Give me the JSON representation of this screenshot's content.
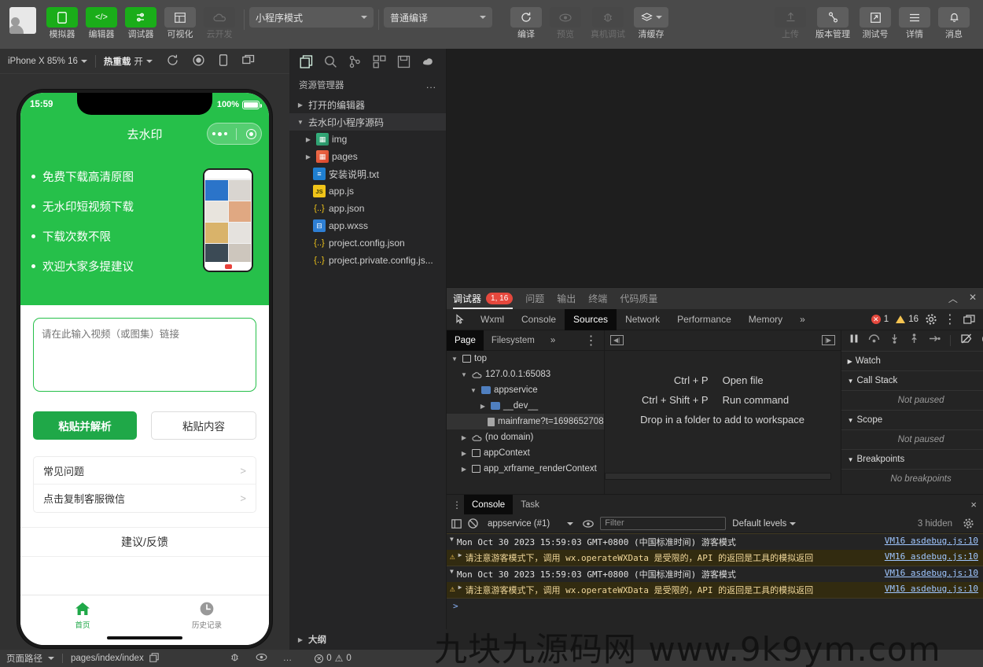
{
  "toolbar": {
    "avatar_name": "user-avatar",
    "items": [
      {
        "label": "模拟器",
        "icon": "phone-icon",
        "style": "green"
      },
      {
        "label": "编辑器",
        "icon": "code-icon",
        "style": "green"
      },
      {
        "label": "调试器",
        "icon": "debug-icon",
        "style": "green"
      },
      {
        "label": "可视化",
        "icon": "layout-icon",
        "style": "grey"
      },
      {
        "label": "云开发",
        "icon": "cloud-icon",
        "style": "dim",
        "disabled": true
      }
    ],
    "mode_select": "小程序模式",
    "compile_select": "普通编译",
    "actions": [
      {
        "label": "编译",
        "icon": "refresh-icon",
        "disabled": false
      },
      {
        "label": "预览",
        "icon": "eye-icon",
        "disabled": true
      },
      {
        "label": "真机调试",
        "icon": "bug-icon",
        "disabled": true
      },
      {
        "label": "清缓存",
        "icon": "layers-icon",
        "disabled": false
      }
    ],
    "right_actions": [
      {
        "label": "上传",
        "icon": "upload-icon",
        "disabled": true
      },
      {
        "label": "版本管理",
        "icon": "branch-icon",
        "disabled": false
      },
      {
        "label": "测试号",
        "icon": "external-link-icon",
        "disabled": false
      },
      {
        "label": "详情",
        "icon": "menu-icon",
        "disabled": false
      },
      {
        "label": "消息",
        "icon": "bell-icon",
        "disabled": false
      }
    ]
  },
  "simulator": {
    "device": "iPhone X 85% 16",
    "hotreload_label": "热重载",
    "hotreload_value": "开",
    "icons": [
      "rotate-icon",
      "record-icon",
      "device-icon",
      "multiscreen-icon"
    ],
    "phone": {
      "status_time": "15:59",
      "battery_text": "100%",
      "nav_title": "去水印",
      "promo_items": [
        "免费下载高清原图",
        "无水印短视频下载",
        "下载次数不限",
        "欢迎大家多提建议"
      ],
      "input_placeholder": "请在此输入视频（或图集）链接",
      "input_value": "",
      "primary_button": "粘贴并解析",
      "ghost_button": "粘贴内容",
      "menu_rows": [
        {
          "label": "常见问题",
          "chevron": ">"
        },
        {
          "label": "点击复制客服微信",
          "chevron": ">"
        }
      ],
      "feedback_label": "建议/反馈",
      "tabs": [
        {
          "label": "首页",
          "icon": "home-icon",
          "active": true
        },
        {
          "label": "历史记录",
          "icon": "clock-icon",
          "active": false
        }
      ]
    }
  },
  "explorer": {
    "activity_icons": [
      "files-icon",
      "search-icon",
      "source-control-icon",
      "extensions-icon",
      "save-icon",
      "plugin-icon"
    ],
    "title": "资源管理器",
    "more": "...",
    "sections": [
      {
        "label": "打开的编辑器",
        "expanded": false
      },
      {
        "label": "去水印小程序源码",
        "expanded": true
      }
    ],
    "files": [
      {
        "name": "img",
        "type": "folder-img",
        "expandable": true
      },
      {
        "name": "pages",
        "type": "folder-pages",
        "expandable": true
      },
      {
        "name": "安装说明.txt",
        "type": "txt",
        "expandable": false
      },
      {
        "name": "app.js",
        "type": "js",
        "expandable": false
      },
      {
        "name": "app.json",
        "type": "json",
        "expandable": false
      },
      {
        "name": "app.wxss",
        "type": "wxss",
        "expandable": false
      },
      {
        "name": "project.config.json",
        "type": "json",
        "expandable": false
      },
      {
        "name": "project.private.config.js...",
        "type": "json",
        "expandable": false
      }
    ],
    "outline_label": "大纲"
  },
  "devtools": {
    "panel_tabs": [
      {
        "label": "调试器",
        "badge": "1, 16",
        "active": true
      },
      {
        "label": "问题",
        "badge": "",
        "active": false
      },
      {
        "label": "输出",
        "badge": "",
        "active": false
      },
      {
        "label": "终端",
        "badge": "",
        "active": false
      },
      {
        "label": "代码质量",
        "badge": "",
        "active": false
      }
    ],
    "panel_controls": [
      "collapse-icon",
      "close-icon"
    ],
    "inspector_tabs": [
      {
        "label": "Wxml",
        "active": false
      },
      {
        "label": "Console",
        "active": false
      },
      {
        "label": "Sources",
        "active": true
      },
      {
        "label": "Network",
        "active": false
      },
      {
        "label": "Performance",
        "active": false
      },
      {
        "label": "Memory",
        "active": false
      }
    ],
    "overflow": "»",
    "error_count": "1",
    "warning_count": "16",
    "nav_tabs": [
      {
        "label": "Page",
        "active": true
      },
      {
        "label": "Filesystem",
        "active": false
      }
    ],
    "nav_overflow": "»",
    "source_tree": [
      {
        "label": "top",
        "depth": 0,
        "icon": "frame-icon",
        "arrow": "▼",
        "selected": false
      },
      {
        "label": "127.0.0.1:65083",
        "depth": 1,
        "icon": "cloud-icon",
        "arrow": "▼",
        "selected": false
      },
      {
        "label": "appservice",
        "depth": 2,
        "icon": "folder-icon",
        "arrow": "▼",
        "selected": false
      },
      {
        "label": "__dev__",
        "depth": 3,
        "icon": "folder-icon",
        "arrow": "▶",
        "selected": false
      },
      {
        "label": "mainframe?t=1698652708",
        "depth": 4,
        "icon": "doc-icon",
        "arrow": "",
        "selected": true
      },
      {
        "label": "(no domain)",
        "depth": 1,
        "icon": "cloud-icon",
        "arrow": "▶",
        "selected": false
      },
      {
        "label": "appContext",
        "depth": 1,
        "icon": "frame-icon",
        "arrow": "▶",
        "selected": false
      },
      {
        "label": "app_xrframe_renderContext",
        "depth": 1,
        "icon": "frame-icon",
        "arrow": "▶",
        "selected": false
      }
    ],
    "hints": [
      {
        "key": "Ctrl + P",
        "value": "Open file"
      },
      {
        "key": "Ctrl + Shift + P",
        "value": "Run command"
      }
    ],
    "hint_drop": "Drop in a folder to add to workspace",
    "debug_buttons": [
      "pause-icon",
      "step-over-icon",
      "step-into-icon",
      "step-out-icon",
      "step-icon",
      "deactivate-breakpoints-icon",
      "pause-on-exceptions-icon"
    ],
    "side_sections": [
      {
        "label": "Watch",
        "arrow": "▶",
        "body": ""
      },
      {
        "label": "Call Stack",
        "arrow": "▼",
        "body": "Not paused"
      },
      {
        "label": "Scope",
        "arrow": "▼",
        "body": "Not paused"
      },
      {
        "label": "Breakpoints",
        "arrow": "▼",
        "body": "No breakpoints"
      }
    ]
  },
  "console": {
    "tabs": [
      {
        "label": "Console",
        "active": true
      },
      {
        "label": "Task",
        "active": false
      }
    ],
    "close_icon": "×",
    "context": "appservice (#1)",
    "filter_placeholder": "Filter",
    "filter_value": "",
    "levels": "Default levels",
    "hidden": "3 hidden",
    "settings_icon": "gear-icon",
    "logs": [
      {
        "type": "group",
        "text": "Mon Oct 30 2023 15:59:03 GMT+0800 (中国标准时间) 游客模式",
        "source": "VM16 asdebug.js:10"
      },
      {
        "type": "warning",
        "text": "请注意游客模式下，调用 wx.operateWXData 是受限的，API 的返回是工具的模拟返回",
        "source": "VM16 asdebug.js:10"
      },
      {
        "type": "group",
        "text": "Mon Oct 30 2023 15:59:03 GMT+0800 (中国标准时间) 游客模式",
        "source": "VM16 asdebug.js:10"
      },
      {
        "type": "warning",
        "text": "请注意游客模式下，调用 wx.operateWXData 是受限的，API 的返回是工具的模拟返回",
        "source": "VM16 asdebug.js:10"
      }
    ],
    "prompt": ">"
  },
  "status_bar": {
    "page_path_label": "页面路径",
    "page_path_value": "pages/index/index",
    "copy_icon": "copy-icon",
    "icons": [
      "bug-icon",
      "eye-icon",
      "more-icon"
    ],
    "error_count": "0",
    "warning_count": "0"
  },
  "watermark": "九块九源码网 www.9k9ym.com",
  "colors": {
    "brand_green": "#1aad19",
    "app_green": "#26c04a",
    "button_green": "#1fa848",
    "error_red": "#e5483d",
    "warning_yellow": "#f5c451",
    "toolbar_bg": "#4a4a4a",
    "panel_bg": "#242424",
    "explorer_bg": "#252526"
  }
}
